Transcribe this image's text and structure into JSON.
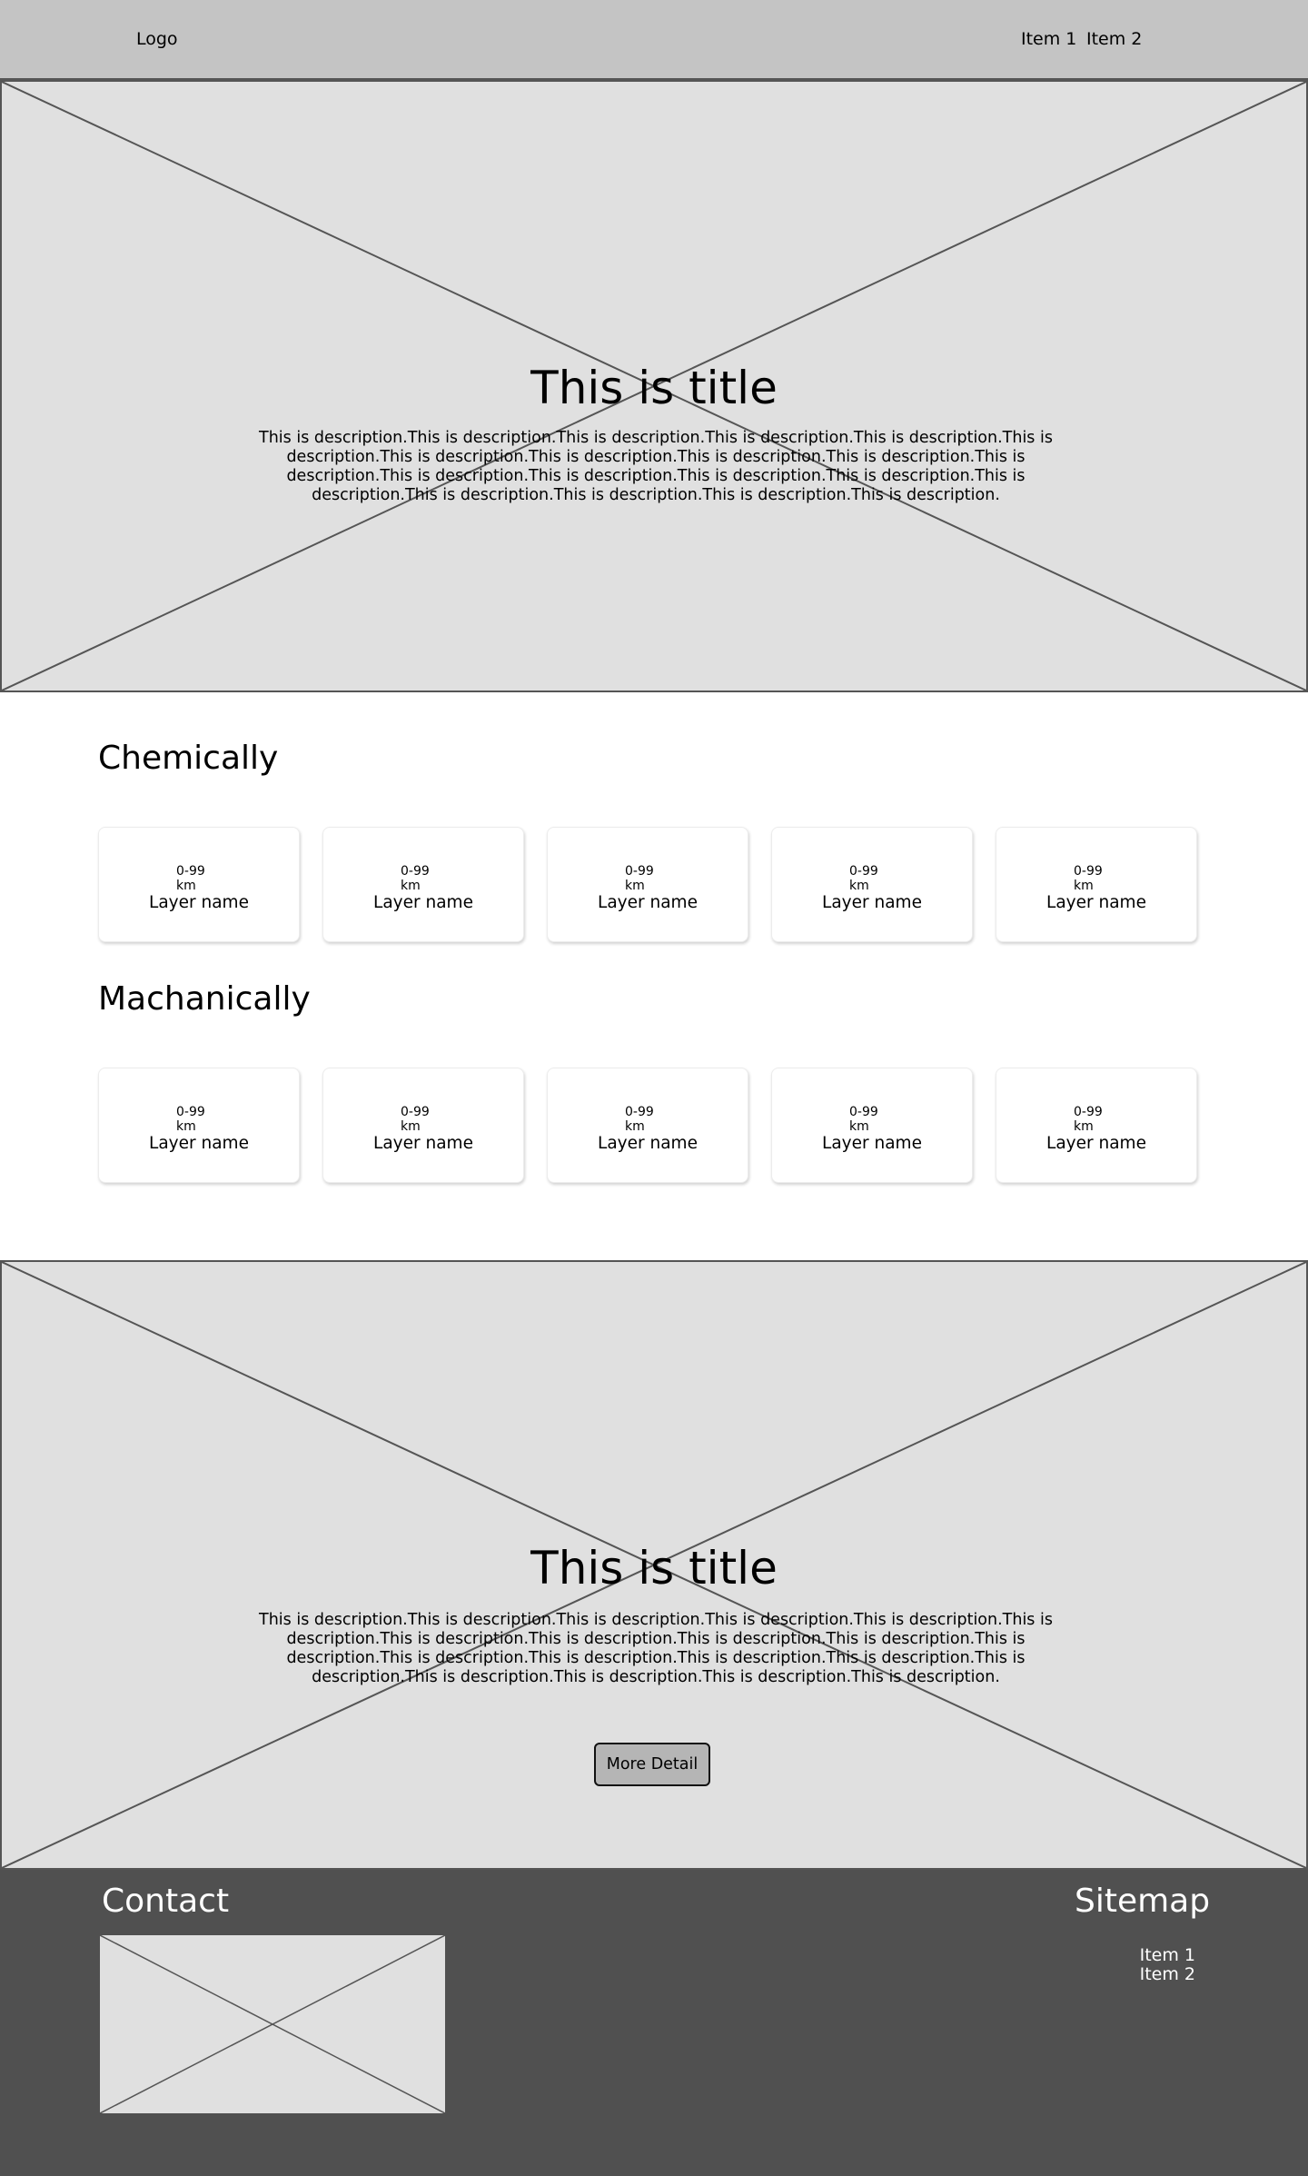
{
  "header": {
    "logo": "Logo",
    "nav": [
      "Item 1",
      "Item 2"
    ]
  },
  "hero1": {
    "title": "This is title",
    "description": "This is description.This is description.This is description.This is description.This is description.This is description.This is description.This is description.This is description.This is description.This is description.This is description.This is description.This is description.This is description.This is description.This is description.This is description.This is description.This is description."
  },
  "sections": [
    {
      "title": "Chemically",
      "cards": [
        {
          "range": "0-99",
          "unit": "km",
          "label": "Layer name"
        },
        {
          "range": "0-99",
          "unit": "km",
          "label": "Layer name"
        },
        {
          "range": "0-99",
          "unit": "km",
          "label": "Layer name"
        },
        {
          "range": "0-99",
          "unit": "km",
          "label": "Layer name"
        },
        {
          "range": "0-99",
          "unit": "km",
          "label": "Layer name"
        }
      ]
    },
    {
      "title": "Machanically",
      "cards": [
        {
          "range": "0-99",
          "unit": "km",
          "label": "Layer name"
        },
        {
          "range": "0-99",
          "unit": "km",
          "label": "Layer name"
        },
        {
          "range": "0-99",
          "unit": "km",
          "label": "Layer name"
        },
        {
          "range": "0-99",
          "unit": "km",
          "label": "Layer name"
        },
        {
          "range": "0-99",
          "unit": "km",
          "label": "Layer name"
        }
      ]
    }
  ],
  "hero2": {
    "title": "This is title",
    "description": "This is description.This is description.This is description.This is description.This is description.This is description.This is description.This is description.This is description.This is description.This is description.This is description.This is description.This is description.This is description.This is description.This is description.This is description.This is description.This is description.",
    "button": "More Detail"
  },
  "footer": {
    "contact_title": "Contact",
    "sitemap_title": "Sitemap",
    "sitemap_items": [
      "Item 1",
      "Item 2"
    ]
  },
  "colors": {
    "header_bg": "#c4c4c4",
    "placeholder_bg": "#e0e0e0",
    "footer_bg": "#505050",
    "button_bg": "#b5b5b5"
  }
}
